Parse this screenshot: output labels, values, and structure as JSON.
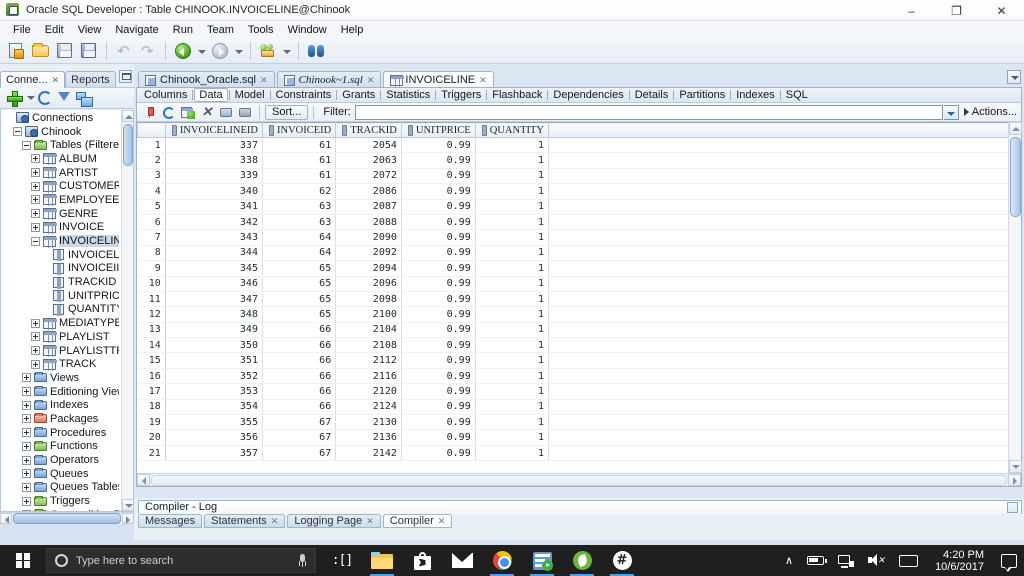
{
  "window": {
    "title": "Oracle SQL Developer : Table CHINOOK.INVOICELINE@Chinook",
    "minimize": "–",
    "restore": "❐",
    "close": "✕"
  },
  "menubar": {
    "items": [
      "File",
      "Edit",
      "View",
      "Navigate",
      "Run",
      "Team",
      "Tools",
      "Window",
      "Help"
    ]
  },
  "toolbar": {
    "buttons": [
      {
        "name": "new-file-button",
        "icon": "new-file-icon",
        "tooltip": "New"
      },
      {
        "name": "open-file-button",
        "icon": "open-folder-icon",
        "tooltip": "Open"
      },
      {
        "name": "save-button",
        "icon": "save-icon",
        "tooltip": "Save"
      },
      {
        "name": "save-all-button",
        "icon": "save-all-icon",
        "tooltip": "Save All"
      },
      {
        "name": "undo-button",
        "icon": "undo-icon",
        "tooltip": "Undo"
      },
      {
        "name": "redo-button",
        "icon": "redo-icon",
        "tooltip": "Redo"
      },
      {
        "name": "back-button",
        "icon": "back-arrow-icon",
        "tooltip": "Back"
      },
      {
        "name": "forward-button",
        "icon": "forward-arrow-icon",
        "tooltip": "Forward"
      },
      {
        "name": "deploy-button",
        "icon": "deploy-icon",
        "tooltip": "Deploy"
      },
      {
        "name": "find-button",
        "icon": "binoculars-icon",
        "tooltip": "Find"
      }
    ]
  },
  "left_panel": {
    "tabs": [
      {
        "label": "Conne...",
        "active": true,
        "closable": true
      },
      {
        "label": "Reports",
        "active": false,
        "closable": false
      }
    ],
    "toolbar_icons": [
      "new-connection-icon",
      "dropdown-arrow-icon",
      "refresh-icon",
      "filter-icon",
      "copy-icon"
    ],
    "tree": [
      {
        "label": "Connections",
        "depth": 0,
        "expander": "none",
        "icon": "connections-icon"
      },
      {
        "label": "Chinook",
        "depth": 1,
        "expander": "minus",
        "icon": "connection-icon"
      },
      {
        "label": "Tables (Filtered)",
        "depth": 2,
        "expander": "minus",
        "icon": "folder-green-icon"
      },
      {
        "label": "ALBUM",
        "depth": 3,
        "expander": "plus",
        "icon": "table-icon"
      },
      {
        "label": "ARTIST",
        "depth": 3,
        "expander": "plus",
        "icon": "table-icon"
      },
      {
        "label": "CUSTOMER",
        "depth": 3,
        "expander": "plus",
        "icon": "table-icon"
      },
      {
        "label": "EMPLOYEE",
        "depth": 3,
        "expander": "plus",
        "icon": "table-icon"
      },
      {
        "label": "GENRE",
        "depth": 3,
        "expander": "plus",
        "icon": "table-icon"
      },
      {
        "label": "INVOICE",
        "depth": 3,
        "expander": "plus",
        "icon": "table-icon"
      },
      {
        "label": "INVOICELINE",
        "depth": 3,
        "expander": "minus",
        "icon": "table-icon",
        "selected": true
      },
      {
        "label": "INVOICELI",
        "depth": 4,
        "expander": "none",
        "icon": "column-icon"
      },
      {
        "label": "INVOICEII",
        "depth": 4,
        "expander": "none",
        "icon": "column-icon"
      },
      {
        "label": "TRACKID",
        "depth": 4,
        "expander": "none",
        "icon": "column-icon"
      },
      {
        "label": "UNITPRIC",
        "depth": 4,
        "expander": "none",
        "icon": "column-icon"
      },
      {
        "label": "QUANTITY",
        "depth": 4,
        "expander": "none",
        "icon": "column-icon"
      },
      {
        "label": "MEDIATYPE",
        "depth": 3,
        "expander": "plus",
        "icon": "table-icon"
      },
      {
        "label": "PLAYLIST",
        "depth": 3,
        "expander": "plus",
        "icon": "table-icon"
      },
      {
        "label": "PLAYLISTTRAC",
        "depth": 3,
        "expander": "plus",
        "icon": "table-icon"
      },
      {
        "label": "TRACK",
        "depth": 3,
        "expander": "plus",
        "icon": "table-icon"
      },
      {
        "label": "Views",
        "depth": 2,
        "expander": "plus",
        "icon": "folder-blue-icon"
      },
      {
        "label": "Editioning Views",
        "depth": 2,
        "expander": "plus",
        "icon": "folder-blue-icon"
      },
      {
        "label": "Indexes",
        "depth": 2,
        "expander": "plus",
        "icon": "folder-blue-icon"
      },
      {
        "label": "Packages",
        "depth": 2,
        "expander": "plus",
        "icon": "folder-red-icon"
      },
      {
        "label": "Procedures",
        "depth": 2,
        "expander": "plus",
        "icon": "folder-blue-icon"
      },
      {
        "label": "Functions",
        "depth": 2,
        "expander": "plus",
        "icon": "folder-green-icon"
      },
      {
        "label": "Operators",
        "depth": 2,
        "expander": "plus",
        "icon": "folder-blue-icon"
      },
      {
        "label": "Queues",
        "depth": 2,
        "expander": "plus",
        "icon": "folder-blue-icon"
      },
      {
        "label": "Queues Tables",
        "depth": 2,
        "expander": "plus",
        "icon": "folder-blue-icon"
      },
      {
        "label": "Triggers",
        "depth": 2,
        "expander": "plus",
        "icon": "folder-green-icon"
      },
      {
        "label": "Crossedition Trigg",
        "depth": 2,
        "expander": "plus",
        "icon": "folder-green-icon"
      }
    ]
  },
  "editor": {
    "tabs": [
      {
        "label": "Chinook_Oracle.sql",
        "icon": "sql-file-icon",
        "active": false,
        "italic": false
      },
      {
        "label": "Chinook~1.sql",
        "icon": "sql-file-icon",
        "active": false,
        "italic": true
      },
      {
        "label": "INVOICELINE",
        "icon": "table-icon",
        "active": true,
        "italic": false
      }
    ],
    "subtabs": [
      {
        "label": "Columns",
        "active": false
      },
      {
        "label": "Data",
        "active": true
      },
      {
        "label": "Model",
        "active": false
      },
      {
        "label": "Constraints",
        "active": false
      },
      {
        "label": "Grants",
        "active": false
      },
      {
        "label": "Statistics",
        "active": false
      },
      {
        "label": "Triggers",
        "active": false
      },
      {
        "label": "Flashback",
        "active": false
      },
      {
        "label": "Dependencies",
        "active": false
      },
      {
        "label": "Details",
        "active": false
      },
      {
        "label": "Partitions",
        "active": false
      },
      {
        "label": "Indexes",
        "active": false
      },
      {
        "label": "SQL",
        "active": false
      }
    ],
    "gridbar": {
      "icons": [
        {
          "name": "freeze-pin-button",
          "icon": "pin-icon"
        },
        {
          "name": "refresh-data-button",
          "icon": "refresh-icon"
        },
        {
          "name": "insert-row-button",
          "icon": "add-row-icon"
        },
        {
          "name": "delete-row-button",
          "icon": "delete-row-icon"
        },
        {
          "name": "commit-button",
          "icon": "commit-icon"
        },
        {
          "name": "rollback-button",
          "icon": "rollback-icon"
        }
      ],
      "sort_label": "Sort...",
      "filter_label": "Filter:",
      "filter_value": "",
      "filter_placeholder": "",
      "actions_label": "Actions..."
    },
    "grid": {
      "columns": [
        "INVOICELINEID",
        "INVOICEID",
        "TRACKID",
        "UNITPRICE",
        "QUANTITY"
      ],
      "rows": [
        {
          "n": "1",
          "cells": [
            "337",
            "61",
            "2054",
            "0.99",
            "1"
          ]
        },
        {
          "n": "2",
          "cells": [
            "338",
            "61",
            "2063",
            "0.99",
            "1"
          ]
        },
        {
          "n": "3",
          "cells": [
            "339",
            "61",
            "2072",
            "0.99",
            "1"
          ]
        },
        {
          "n": "4",
          "cells": [
            "340",
            "62",
            "2086",
            "0.99",
            "1"
          ]
        },
        {
          "n": "5",
          "cells": [
            "341",
            "63",
            "2087",
            "0.99",
            "1"
          ]
        },
        {
          "n": "6",
          "cells": [
            "342",
            "63",
            "2088",
            "0.99",
            "1"
          ]
        },
        {
          "n": "7",
          "cells": [
            "343",
            "64",
            "2090",
            "0.99",
            "1"
          ]
        },
        {
          "n": "8",
          "cells": [
            "344",
            "64",
            "2092",
            "0.99",
            "1"
          ]
        },
        {
          "n": "9",
          "cells": [
            "345",
            "65",
            "2094",
            "0.99",
            "1"
          ]
        },
        {
          "n": "10",
          "cells": [
            "346",
            "65",
            "2096",
            "0.99",
            "1"
          ]
        },
        {
          "n": "11",
          "cells": [
            "347",
            "65",
            "2098",
            "0.99",
            "1"
          ]
        },
        {
          "n": "12",
          "cells": [
            "348",
            "65",
            "2100",
            "0.99",
            "1"
          ]
        },
        {
          "n": "13",
          "cells": [
            "349",
            "66",
            "2104",
            "0.99",
            "1"
          ]
        },
        {
          "n": "14",
          "cells": [
            "350",
            "66",
            "2108",
            "0.99",
            "1"
          ]
        },
        {
          "n": "15",
          "cells": [
            "351",
            "66",
            "2112",
            "0.99",
            "1"
          ]
        },
        {
          "n": "16",
          "cells": [
            "352",
            "66",
            "2116",
            "0.99",
            "1"
          ]
        },
        {
          "n": "17",
          "cells": [
            "353",
            "66",
            "2120",
            "0.99",
            "1"
          ]
        },
        {
          "n": "18",
          "cells": [
            "354",
            "66",
            "2124",
            "0.99",
            "1"
          ]
        },
        {
          "n": "19",
          "cells": [
            "355",
            "67",
            "2130",
            "0.99",
            "1"
          ]
        },
        {
          "n": "20",
          "cells": [
            "356",
            "67",
            "2136",
            "0.99",
            "1"
          ]
        },
        {
          "n": "21",
          "cells": [
            "357",
            "67",
            "2142",
            "0.99",
            "1"
          ]
        }
      ]
    }
  },
  "log_panel": {
    "title": "Compiler - Log",
    "tabs": [
      {
        "label": "Messages",
        "active": false,
        "closable": false
      },
      {
        "label": "Statements",
        "active": false,
        "closable": true
      },
      {
        "label": "Logging Page",
        "active": false,
        "closable": true
      },
      {
        "label": "Compiler",
        "active": true,
        "closable": true
      }
    ]
  },
  "taskbar": {
    "start_label": "Start",
    "search_placeholder": "Type here to search",
    "apps": [
      {
        "name": "task-view-button",
        "icon": "task-view-icon",
        "running": false
      },
      {
        "name": "file-explorer-button",
        "icon": "file-explorer-icon",
        "running": true
      },
      {
        "name": "microsoft-store-button",
        "icon": "store-icon",
        "running": false
      },
      {
        "name": "mail-button",
        "icon": "mail-icon",
        "running": false
      },
      {
        "name": "chrome-button",
        "icon": "chrome-icon",
        "running": true
      },
      {
        "name": "sql-developer-button",
        "icon": "sql-developer-icon",
        "running": true
      },
      {
        "name": "spring-tool-suite-button",
        "icon": "spring-icon",
        "running": true
      },
      {
        "name": "hash-app-button",
        "icon": "hash-icon",
        "running": true
      }
    ],
    "tray": {
      "chevron": "∧",
      "battery": "battery-icon",
      "network": "network-icon",
      "volume": "volume-muted-icon",
      "keyboard": "keyboard-icon",
      "time": "4:20 PM",
      "date": "10/6/2017",
      "notifications": "notification-icon"
    }
  }
}
